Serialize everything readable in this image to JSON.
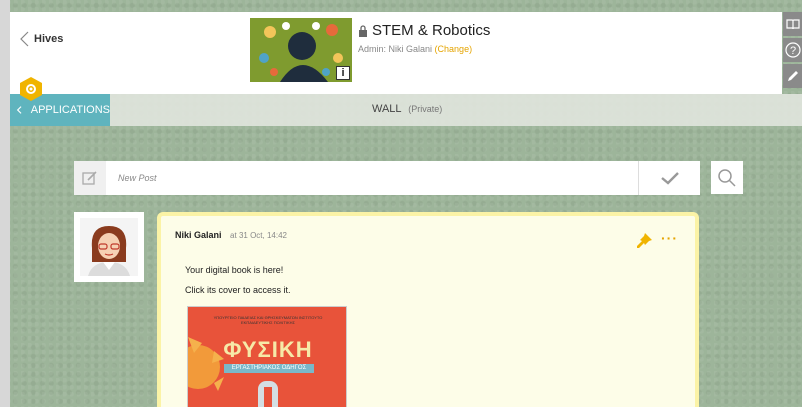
{
  "nav": {
    "back_label": "Hives"
  },
  "hive": {
    "title": "STEM & Robotics",
    "admin_prefix": "Admin: Niki Galani",
    "change_label": "(Change)",
    "info_label": "i"
  },
  "subbar": {
    "apps_label": "APPLICATIONS",
    "wall_label": "WALL",
    "wall_privacy": "(Private)"
  },
  "composer": {
    "placeholder": "New Post"
  },
  "post": {
    "author": "Niki Galani",
    "date": "at 31 Oct, 14:42",
    "line1": "Your digital book is here!",
    "line2": "Click its cover to access it.",
    "book": {
      "title": "ΦΥΣΙΚΗ",
      "subtitle": "ΕΡΓΑΣΤΗΡΙΑΚΟΣ ΟΔΗΓΟΣ",
      "top_text": "ΥΠΟΥΡΓΕΙΟ ΠΑΙΔΕΙΑΣ ΚΑΙ ΘΡΗΣΚΕΥΜΑΤΩΝ ΙΝΣΤΙΤΟΥΤΟ ΕΚΠΑΙΔΕΥΤΙΚΗΣ ΠΟΛΙΤΙΚΗΣ"
    }
  },
  "colors": {
    "accent": "#e5a400",
    "apps_bg": "#5fb4be",
    "post_border": "#fbf3a6"
  }
}
